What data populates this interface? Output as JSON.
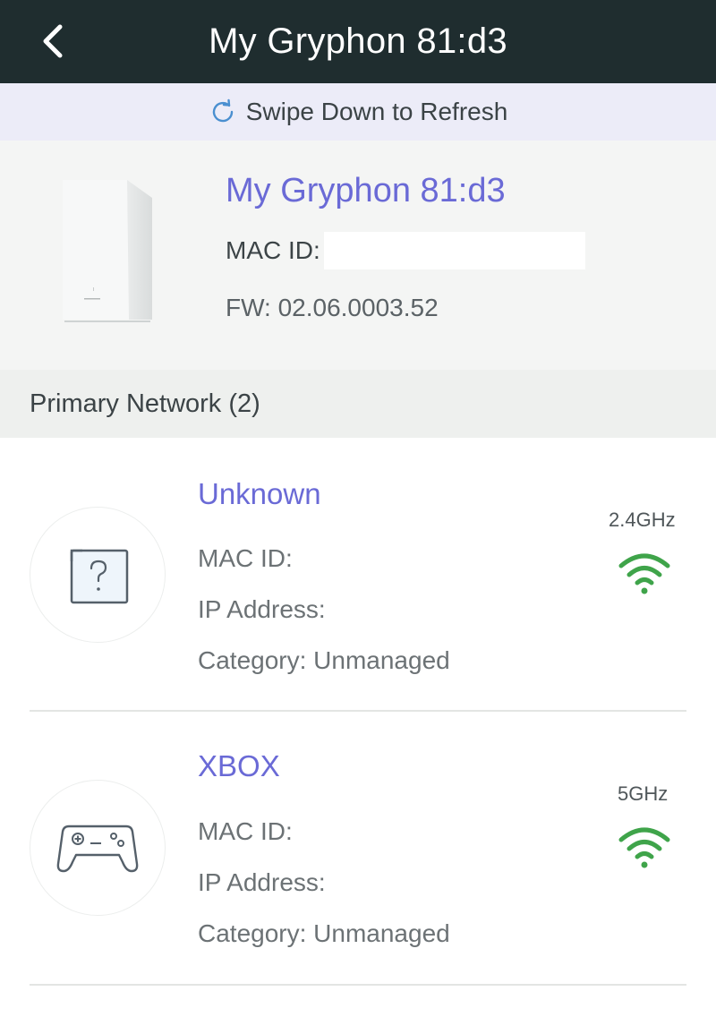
{
  "header": {
    "title": "My Gryphon 81:d3",
    "back_icon": "chevron-left-icon"
  },
  "refresh": {
    "text": "Swipe Down to Refresh",
    "icon": "refresh-icon"
  },
  "router": {
    "name": "My Gryphon 81:d3",
    "mac_label": "MAC ID:",
    "firmware": "FW: 02.06.0003.52"
  },
  "section": {
    "title": "Primary Network (2)"
  },
  "devices": [
    {
      "name": "Unknown",
      "mac_label": "MAC ID:",
      "ip_label": "IP Address:",
      "category": "Category: Unmanaged",
      "band": "2.4GHz",
      "icon": "question-box-icon"
    },
    {
      "name": "XBOX",
      "mac_label": "MAC ID:",
      "ip_label": "IP Address:",
      "category": "Category: Unmanaged",
      "band": "5GHz",
      "icon": "game-controller-icon"
    }
  ],
  "colors": {
    "topbar": "#1f2d2f",
    "accent": "#6a6ad6",
    "wifi_signal": "#3fa44a"
  }
}
